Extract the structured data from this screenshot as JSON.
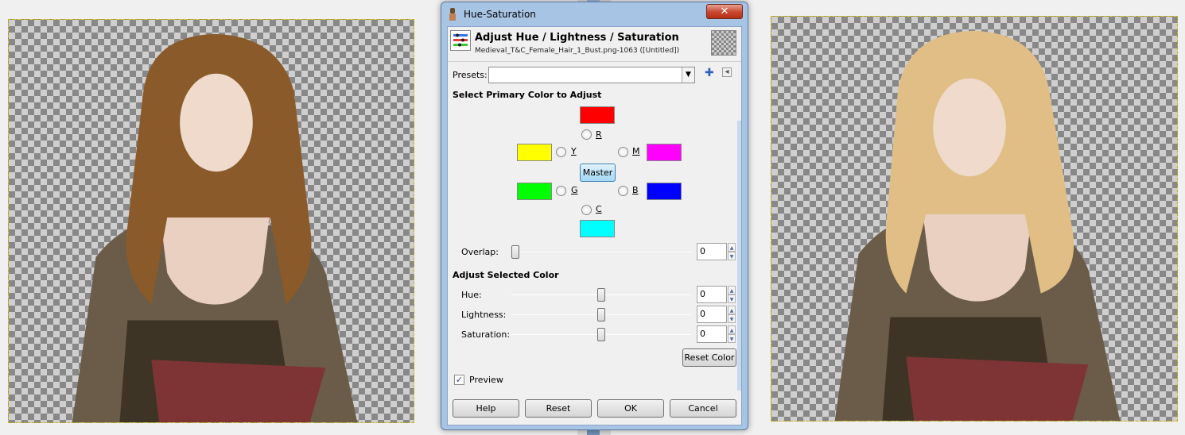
{
  "dialog": {
    "window_title": "Hue-Saturation",
    "close_label": "✕",
    "header_title": "Adjust Hue / Lightness / Saturation",
    "header_subtitle": "Medieval_T&C_Female_Hair_1_Bust.png-1063 ([Untitled])"
  },
  "presets": {
    "label": "Presets:",
    "value": ""
  },
  "primary_color": {
    "heading": "Select Primary Color to Adjust",
    "options": [
      {
        "key": "R",
        "color": "#ff0000"
      },
      {
        "key": "Y",
        "color": "#ffff00"
      },
      {
        "key": "M",
        "color": "#ff00ff"
      },
      {
        "key": "G",
        "color": "#00ff00"
      },
      {
        "key": "B",
        "color": "#0000ff"
      },
      {
        "key": "C",
        "color": "#00ffff"
      }
    ],
    "master_label": "Master"
  },
  "overlap": {
    "label": "Overlap:",
    "value": "0"
  },
  "adjust": {
    "heading": "Adjust Selected Color",
    "hue": {
      "label": "Hue:",
      "value": "0"
    },
    "lightness": {
      "label": "Lightness:",
      "value": "0"
    },
    "saturation": {
      "label": "Saturation:",
      "value": "0"
    },
    "reset_color_label": "Reset Color"
  },
  "preview": {
    "label": "Preview",
    "checked": true
  },
  "buttons": {
    "help": "Help",
    "reset": "Reset",
    "ok": "OK",
    "cancel": "Cancel"
  },
  "canvases": {
    "left_hair_color": "#8a5a2a",
    "right_hair_color": "#e0be86"
  }
}
